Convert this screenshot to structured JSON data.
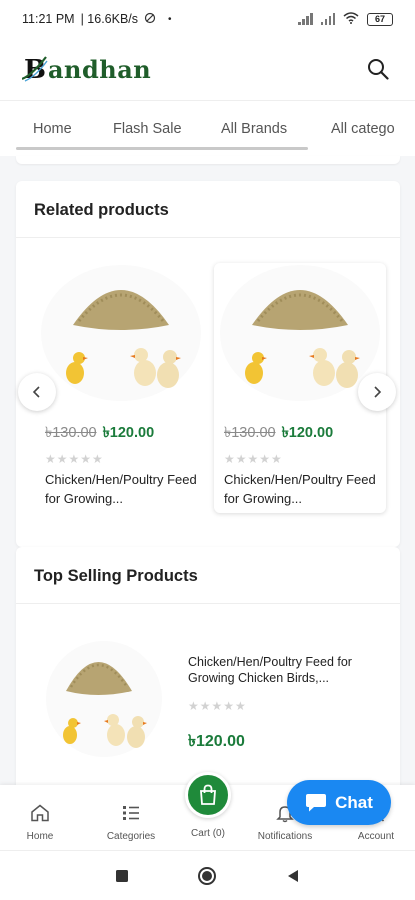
{
  "status_bar": {
    "time": "11:21 PM",
    "speed": "| 16.6KB/s",
    "battery": "67"
  },
  "header": {
    "logo_text": "andhan",
    "logo_letter": "B"
  },
  "nav_tabs": [
    "Home",
    "Flash Sale",
    "All Brands",
    "All catego"
  ],
  "related": {
    "title": "Related products",
    "products": [
      {
        "old_price": "৳130.00",
        "new_price": "৳120.00",
        "stars": "★★★★★",
        "name": "Chicken/Hen/Poultry Feed for Growing..."
      },
      {
        "old_price": "৳130.00",
        "new_price": "৳120.00",
        "stars": "★★★★★",
        "name": "Chicken/Hen/Poultry Feed for Growing..."
      }
    ]
  },
  "top_selling": {
    "title": "Top Selling Products",
    "product": {
      "name": "Chicken/Hen/Poultry Feed for Growing Chicken Birds,...",
      "stars": "★★★★★",
      "price": "৳120.00"
    }
  },
  "bottom_nav": {
    "home": "Home",
    "categories": "Categories",
    "cart": "Cart (0)",
    "notifications": "Notifications",
    "account": "Account"
  },
  "chat": {
    "label": "Chat"
  },
  "colors": {
    "brand_green": "#1b7b3b",
    "chat_blue": "#1a88f2",
    "cart_green": "#1f8a3a"
  },
  "icons": [
    "dnd-icon",
    "signal-icon",
    "wifi-icon",
    "battery-icon",
    "search-icon",
    "chevron-left-icon",
    "chevron-right-icon",
    "home-icon",
    "list-icon",
    "shopping-bag-icon",
    "bell-icon",
    "chat-bubble-icon",
    "square-icon",
    "circle-icon",
    "triangle-back-icon"
  ]
}
